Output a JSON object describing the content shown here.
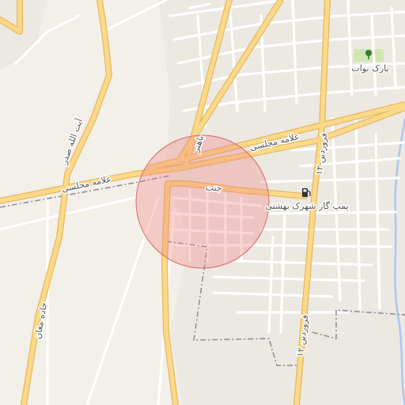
{
  "map": {
    "labels": {
      "allameh_majlesi_west": "علامه مجلسی",
      "allameh_majlesi_east": "علامه مجلسی",
      "ayatollah_sadr": "آیت الله صدر",
      "jadde_moghan": "جاده مغان",
      "bahonar": "باهنر",
      "jannat": "جنت",
      "farvardin_north": "۱۲ فروردین",
      "farvardin_south": "۱۲ فروردین",
      "park_navvab": "پارک نواب",
      "gas_station": "پمپ گاز شهرک بهشتی"
    },
    "icons": {
      "park": "tree-icon",
      "gas_station": "fuel-pump-icon"
    },
    "colors": {
      "background": "#f3efe9",
      "block": "#ece8e2",
      "minor_road": "#ffffff",
      "major_road_fill": "#fbd98a",
      "major_road_casing": "#e8b95d",
      "boundary": "#8c8a96",
      "river": "#a9c8ee",
      "park": "#cfe6b3",
      "highlight_fill": "#f08080",
      "highlight_stroke": "#e06a6a"
    }
  }
}
